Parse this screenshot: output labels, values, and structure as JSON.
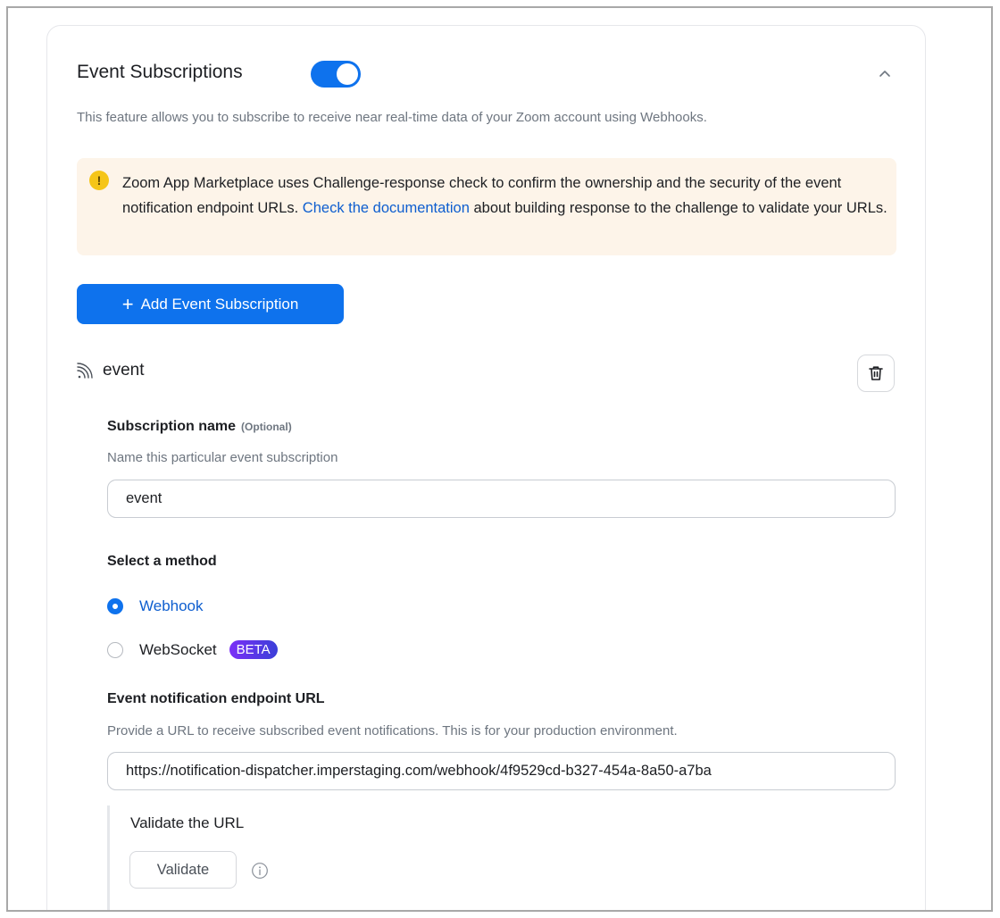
{
  "section": {
    "title": "Event Subscriptions",
    "enabled": true,
    "description": "This feature allows you to subscribe to receive near real-time data of your Zoom account using Webhooks."
  },
  "notice": {
    "icon": "warning-icon",
    "text_before": "Zoom App Marketplace uses Challenge-response check to confirm the ownership and the security of the event notification endpoint URLs. ",
    "link_text": "Check the documentation",
    "text_after": " about building response to the challenge to validate your URLs."
  },
  "add_button": {
    "plus": "+",
    "label": "Add Event Subscription"
  },
  "subscription": {
    "name": "event",
    "name_field": {
      "label": "Subscription name",
      "optional": "(Optional)",
      "helper": "Name this particular event subscription",
      "value": "event"
    },
    "method": {
      "label": "Select a method",
      "options": [
        {
          "label": "Webhook",
          "selected": true
        },
        {
          "label": "WebSocket",
          "selected": false,
          "badge": "BETA"
        }
      ]
    },
    "endpoint": {
      "label": "Event notification endpoint URL",
      "helper": "Provide a URL to receive subscribed event notifications. This is for your production environment.",
      "value": "https://notification-dispatcher.imperstaging.com/webhook/4f9529cd-b327-454a-8a50-a7ba"
    },
    "validate": {
      "title": "Validate the URL",
      "button": "Validate"
    }
  },
  "colors": {
    "accent": "#0e72ed",
    "link": "#0e5ecf",
    "notice_bg": "#fdf4e9",
    "warning": "#f5c518"
  }
}
